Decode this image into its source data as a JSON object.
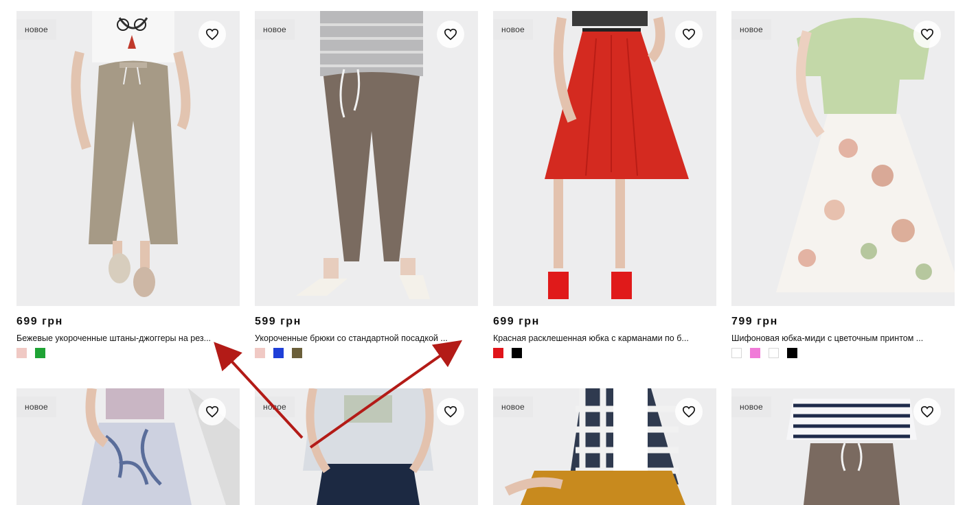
{
  "colors": {
    "arrow": "#b31b17",
    "photo_bg": "#ededee"
  },
  "products": [
    {
      "badge": "новое",
      "price": "699 грн",
      "title": "Бежевые укороченные штаны-джоггеры на рез...",
      "swatches": [
        "#f0c9c4",
        "#1fa335"
      ],
      "favorite_icon": "heart-icon"
    },
    {
      "badge": "новое",
      "price": "599 грн",
      "title": "Укороченные брюки со стандартной посадкой ...",
      "swatches": [
        "#f0c9c4",
        "#1f3fd8",
        "#6b5f3a"
      ],
      "favorite_icon": "heart-icon"
    },
    {
      "badge": "новое",
      "price": "699 грн",
      "title": "Красная расклешенная юбка с карманами по б...",
      "swatches": [
        "#e0141a",
        "#000000"
      ],
      "favorite_icon": "heart-icon"
    },
    {
      "badge": "новое",
      "price": "799 грн",
      "title": "Шифоновая юбка-миди с цветочным принтом ...",
      "swatches": [
        "#ffffff",
        "#f07ad8",
        "#ffffff",
        "#000000"
      ],
      "favorite_icon": "heart-icon"
    }
  ],
  "second_row": [
    {
      "badge": "новое",
      "favorite_icon": "heart-icon"
    },
    {
      "badge": "новое",
      "favorite_icon": "heart-icon"
    },
    {
      "badge": "новое",
      "favorite_icon": "heart-icon"
    },
    {
      "badge": "новое",
      "favorite_icon": "heart-icon"
    }
  ]
}
